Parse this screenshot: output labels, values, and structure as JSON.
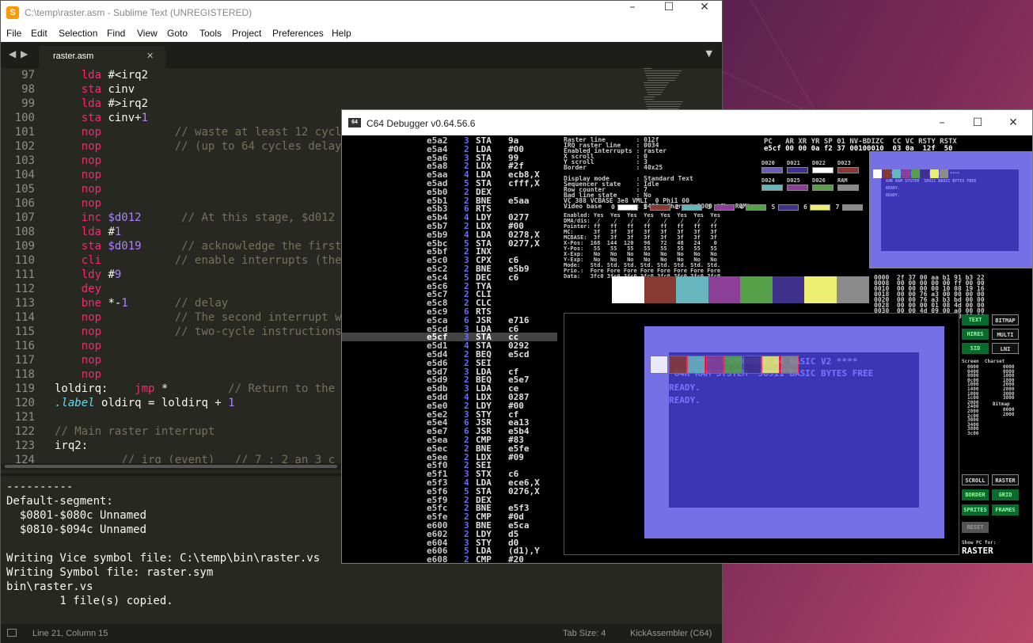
{
  "sublime": {
    "title": "C:\\temp\\raster.asm - Sublime Text (UNREGISTERED)",
    "menu": [
      "File",
      "Edit",
      "Selection",
      "Find",
      "View",
      "Goto",
      "Tools",
      "Project",
      "Preferences",
      "Help"
    ],
    "tab_label": "raster.asm",
    "code_lines": [
      {
        "n": "97",
        "t": [
          [
            "",
            "    "
          ],
          [
            "kw",
            "lda"
          ],
          [
            "",
            " #<irq2"
          ]
        ]
      },
      {
        "n": "98",
        "t": [
          [
            "",
            "    "
          ],
          [
            "kw",
            "sta"
          ],
          [
            "",
            " cinv"
          ]
        ]
      },
      {
        "n": "99",
        "t": [
          [
            "",
            "    "
          ],
          [
            "kw",
            "lda"
          ],
          [
            "",
            " #>irq2"
          ]
        ]
      },
      {
        "n": "100",
        "t": [
          [
            "",
            "    "
          ],
          [
            "kw",
            "sta"
          ],
          [
            "",
            " cinv+"
          ],
          [
            "num",
            "1"
          ]
        ]
      },
      {
        "n": "101",
        "t": [
          [
            "",
            "    "
          ],
          [
            "kw",
            "nop"
          ],
          [
            "cm",
            "           // waste at least 12 cycle"
          ]
        ]
      },
      {
        "n": "102",
        "t": [
          [
            "",
            "    "
          ],
          [
            "kw",
            "nop"
          ],
          [
            "cm",
            "           // (up to 64 cycles delay"
          ]
        ]
      },
      {
        "n": "103",
        "t": [
          [
            "",
            "    "
          ],
          [
            "kw",
            "nop"
          ]
        ]
      },
      {
        "n": "104",
        "t": [
          [
            "",
            "    "
          ],
          [
            "kw",
            "nop"
          ]
        ]
      },
      {
        "n": "105",
        "t": [
          [
            "",
            "    "
          ],
          [
            "kw",
            "nop"
          ]
        ]
      },
      {
        "n": "106",
        "t": [
          [
            "",
            "    "
          ],
          [
            "kw",
            "nop"
          ]
        ]
      },
      {
        "n": "107",
        "t": [
          [
            "",
            "    "
          ],
          [
            "kw",
            "inc"
          ],
          [
            "num",
            " $d012"
          ],
          [
            "cm",
            "      // At this stage, $d012 ha"
          ]
        ]
      },
      {
        "n": "108",
        "t": [
          [
            "",
            "    "
          ],
          [
            "kw",
            "lda"
          ],
          [
            "",
            " #"
          ],
          [
            "num",
            "1"
          ]
        ]
      },
      {
        "n": "109",
        "t": [
          [
            "",
            "    "
          ],
          [
            "kw",
            "sta"
          ],
          [
            "num",
            " $d019"
          ],
          [
            "cm",
            "      // acknowledge the first r"
          ]
        ]
      },
      {
        "n": "110",
        "t": [
          [
            "",
            "    "
          ],
          [
            "kw",
            "cli"
          ],
          [
            "cm",
            "           // enable interrupts (the"
          ]
        ]
      },
      {
        "n": "111",
        "t": [
          [
            "",
            "    "
          ],
          [
            "kw",
            "ldy"
          ],
          [
            "",
            " #"
          ],
          [
            "num",
            "9"
          ]
        ]
      },
      {
        "n": "112",
        "t": [
          [
            "",
            "    "
          ],
          [
            "kw",
            "dey"
          ]
        ]
      },
      {
        "n": "113",
        "t": [
          [
            "",
            "    "
          ],
          [
            "kw",
            "bne"
          ],
          [
            "",
            " *-"
          ],
          [
            "num",
            "1"
          ],
          [
            "cm",
            "       // delay"
          ]
        ]
      },
      {
        "n": "114",
        "t": [
          [
            "",
            "    "
          ],
          [
            "kw",
            "nop"
          ],
          [
            "cm",
            "           // The second interrupt wi"
          ]
        ]
      },
      {
        "n": "115",
        "t": [
          [
            "",
            "    "
          ],
          [
            "kw",
            "nop"
          ],
          [
            "cm",
            "           // two-cycle instructions."
          ]
        ]
      },
      {
        "n": "116",
        "t": [
          [
            "",
            "    "
          ],
          [
            "kw",
            "nop"
          ]
        ]
      },
      {
        "n": "117",
        "t": [
          [
            "",
            "    "
          ],
          [
            "kw",
            "nop"
          ]
        ]
      },
      {
        "n": "118",
        "t": [
          [
            "",
            "    "
          ],
          [
            "kw",
            "nop"
          ]
        ]
      },
      {
        "n": "119",
        "t": [
          [
            "",
            "loldirq:    "
          ],
          [
            "kw",
            "jmp"
          ],
          [
            "",
            " *"
          ],
          [
            "cm",
            "         // Return to the o"
          ]
        ]
      },
      {
        "n": "120",
        "t": [
          [
            "lbl2",
            ".label"
          ],
          [
            "",
            " oldirq = loldirq + "
          ],
          [
            "num",
            "1"
          ]
        ]
      },
      {
        "n": "121",
        "t": []
      },
      {
        "n": "122",
        "t": [
          [
            "cm",
            "// Main raster interrupt"
          ]
        ]
      },
      {
        "n": "123",
        "t": [
          [
            "",
            "irq2:"
          ]
        ]
      },
      {
        "n": "124",
        "t": [
          [
            "cm",
            "          // irq (event)   // 7 : 2 an 3 c"
          ]
        ]
      }
    ],
    "output_lines": [
      "----------",
      "Default-segment:",
      "  $0801-$080c Unnamed",
      "  $0810-$094c Unnamed",
      "",
      "Writing Vice symbol file: C:\\temp\\bin\\raster.vs",
      "Writing Symbol file: raster.sym",
      "bin\\raster.vs",
      "        1 file(s) copied."
    ],
    "status": {
      "position": "Line 21, Column 15",
      "tab_size": "Tab Size: 4",
      "syntax": "KickAssembler (C64)"
    }
  },
  "c64": {
    "title": "C64 Debugger v0.64.56.6",
    "disassembly": [
      [
        "e5a2",
        "3",
        "STA",
        "9a"
      ],
      [
        "e5a4",
        "2",
        "LDA",
        "#00"
      ],
      [
        "e5a6",
        "3",
        "STA",
        "99"
      ],
      [
        "e5a8",
        "2",
        "LDX",
        "#2f"
      ],
      [
        "e5aa",
        "4",
        "LDA",
        "ecb8,X"
      ],
      [
        "e5ad",
        "5",
        "STA",
        "cfff,X"
      ],
      [
        "e5b0",
        "2",
        "DEX",
        ""
      ],
      [
        "e5b1",
        "2",
        "BNE",
        "e5aa"
      ],
      [
        "e5b3",
        "6",
        "RTS",
        ""
      ],
      [
        "e5b4",
        "4",
        "LDY",
        "0277"
      ],
      [
        "e5b7",
        "2",
        "LDX",
        "#00"
      ],
      [
        "e5b9",
        "4",
        "LDA",
        "0278,X"
      ],
      [
        "e5bc",
        "5",
        "STA",
        "0277,X"
      ],
      [
        "e5bf",
        "2",
        "INX",
        ""
      ],
      [
        "e5c0",
        "3",
        "CPX",
        "c6"
      ],
      [
        "e5c2",
        "2",
        "BNE",
        "e5b9"
      ],
      [
        "e5c4",
        "5",
        "DEC",
        "c6"
      ],
      [
        "e5c6",
        "2",
        "TYA",
        ""
      ],
      [
        "e5c7",
        "2",
        "CLI",
        ""
      ],
      [
        "e5c8",
        "2",
        "CLC",
        ""
      ],
      [
        "e5c9",
        "6",
        "RTS",
        ""
      ],
      [
        "e5ca",
        "6",
        "JSR",
        "e716"
      ],
      [
        "e5cd",
        "3",
        "LDA",
        "c6"
      ],
      [
        "e5cf",
        "3",
        "STA",
        "cc"
      ],
      [
        "e5d1",
        "4",
        "STA",
        "0292"
      ],
      [
        "e5d4",
        "2",
        "BEQ",
        "e5cd"
      ],
      [
        "e5d6",
        "2",
        "SEI",
        ""
      ],
      [
        "e5d7",
        "3",
        "LDA",
        "cf"
      ],
      [
        "e5d9",
        "2",
        "BEQ",
        "e5e7"
      ],
      [
        "e5db",
        "3",
        "LDA",
        "ce"
      ],
      [
        "e5dd",
        "4",
        "LDX",
        "0287"
      ],
      [
        "e5e0",
        "2",
        "LDY",
        "#00"
      ],
      [
        "e5e2",
        "3",
        "STY",
        "cf"
      ],
      [
        "e5e4",
        "6",
        "JSR",
        "ea13"
      ],
      [
        "e5e7",
        "6",
        "JSR",
        "e5b4"
      ],
      [
        "e5ea",
        "2",
        "CMP",
        "#83"
      ],
      [
        "e5ec",
        "2",
        "BNE",
        "e5fe"
      ],
      [
        "e5ee",
        "2",
        "LDX",
        "#09"
      ],
      [
        "e5f0",
        "2",
        "SEI",
        ""
      ],
      [
        "e5f1",
        "3",
        "STX",
        "c6"
      ],
      [
        "e5f3",
        "4",
        "LDA",
        "ece6,X"
      ],
      [
        "e5f6",
        "5",
        "STA",
        "0276,X"
      ],
      [
        "e5f9",
        "2",
        "DEX",
        ""
      ],
      [
        "e5fc",
        "2",
        "BNE",
        "e5f3"
      ],
      [
        "e5fe",
        "2",
        "CMP",
        "#0d"
      ],
      [
        "e600",
        "3",
        "BNE",
        "e5ca"
      ],
      [
        "e602",
        "2",
        "LDY",
        "d5"
      ],
      [
        "e604",
        "3",
        "STY",
        "d0"
      ],
      [
        "e606",
        "5",
        "LDA",
        "(d1),Y"
      ],
      [
        "e608",
        "2",
        "CMP",
        "#20"
      ]
    ],
    "current_line_index": 23,
    "vic_info": [
      "Raster line        : 012f",
      "IRQ raster line    : 0034",
      "Enabled interrupts : raster",
      "X scroll           : 0",
      "Y scroll           : 3",
      "Border             : 40x25",
      "",
      "Display mode       : Standard Text",
      "Sequencer state    : Idle",
      "Row counter        : 7",
      "Bad line state     : No",
      "VC 388 VCBASE 3e8 VMLI  0 Phi1 00",
      "Video base         : 0400, Charset 1000 (CharROM)"
    ],
    "cpu_header": "PC   AR XR YR SP 01 NV-BDIZC  CC VC RSTY RSTX",
    "cpu_values": "e5cf 00 00 0a f2 37 00100010  03 0a  12f  50",
    "sprite_table": [
      "Enabled: Yes  Yes  Yes  Yes  Yes  Yes  Yes  Yes",
      "DMA/dis:  /    /    /    /    /    /    /    / ",
      "Pointer: ff   ff   ff   ff   ff   ff   ff   ff ",
      "MC:      3f   3f   3f   3f   3f   3f   3f   3f ",
      "MCBASE:  3f   3f   3f   3f   3f   3f   3f   3f ",
      "X-Pos:  168  144  120   96   72   48   24    0 ",
      "Y-Pos:   55   55   55   55   55   55   55   55 ",
      "X-Exp:   No   No   No   No   No   No   No   No ",
      "Y-Exp:   No   No   No   No   No   No   No   No ",
      "Mode:   Std. Std. Std. Std. Std. Std. Std. Std.",
      "Prio.:  Fore Fore Fore Fore Fore Fore Fore Fore",
      "Data:   3fc0 3fc0 3fc0 3fc0 3fc0 3fc0 3fc0 3fc0"
    ],
    "reg_labels": [
      "D020",
      "D021",
      "D022",
      "D023",
      "D024",
      "D025",
      "D026",
      "RAM"
    ],
    "sprite_numbers": [
      "0",
      "1",
      "2",
      "3",
      "4",
      "5",
      "6",
      "7"
    ],
    "sprite_colors": [
      "#ffffff",
      "#883932",
      "#67b6bd",
      "#8b3f96",
      "#55a049",
      "#40318d",
      "#ecef72",
      "#8b8b8b"
    ],
    "reg_colors": [
      "#6c5eb5",
      "#40318d",
      "#ffffff",
      "#883932",
      "#67b6bd",
      "#8b3f96",
      "#55a049",
      "#8b8b8b"
    ],
    "memory_dump": [
      "0000  2f 37 00 aa b1 91 b3 22",
      "0008  00 00 00 00 00 ff 00 00",
      "0010  00 00 00 00 10 08 19 16",
      "0018  00 00 76 a3 00 00 00 00",
      "0020  00 00 76 a3 b3 bd 00 00",
      "0028  00 00 00 01 08 4d 00 00",
      "0030  00 00 4d 09 00 a0 00 00",
      "0038  00 00 00 00 00 00 00 00"
    ],
    "screen_text": [
      "     **** COMMODORE 64 BASIC V2 ****",
      " 64K RAM SYSTEM  38911 BASIC BYTES FREE",
      "READY.",
      "READY."
    ],
    "preview_text": [
      "**** COMMODORE 64 BASIC V2 ****",
      "64K RAM SYSTEM  38911 BASIC BYTES FREE",
      "READY.",
      "READY."
    ],
    "buttons": [
      [
        "TEXT",
        "BITMAP"
      ],
      [
        "HIRES",
        "MULTI"
      ],
      [
        "SID",
        "LNI"
      ]
    ],
    "screen_charset_header": "Screen  Charset",
    "screen_list": [
      "0000",
      "0400",
      "0800",
      "0c00",
      "1000",
      "1400",
      "1800",
      "1c00",
      "2000",
      "2400",
      "2800",
      "2c00",
      "3000",
      "3400",
      "3800",
      "3c00"
    ],
    "charset_list": [
      "0000",
      "0800",
      "1000",
      "1800",
      "2000",
      "2800",
      "3000",
      "3800"
    ],
    "bitmap_label": "Bitmap",
    "bitmap_list": [
      "0000",
      "2000"
    ],
    "bottom_buttons": [
      [
        "SCROLL",
        "RASTER"
      ],
      [
        "BORDER",
        "GRID"
      ],
      [
        "SPRITES",
        "FRAMES"
      ]
    ],
    "reset_label": "RESET",
    "show_pc_for": "Show PC for:",
    "show_pc_value": "RASTER"
  }
}
